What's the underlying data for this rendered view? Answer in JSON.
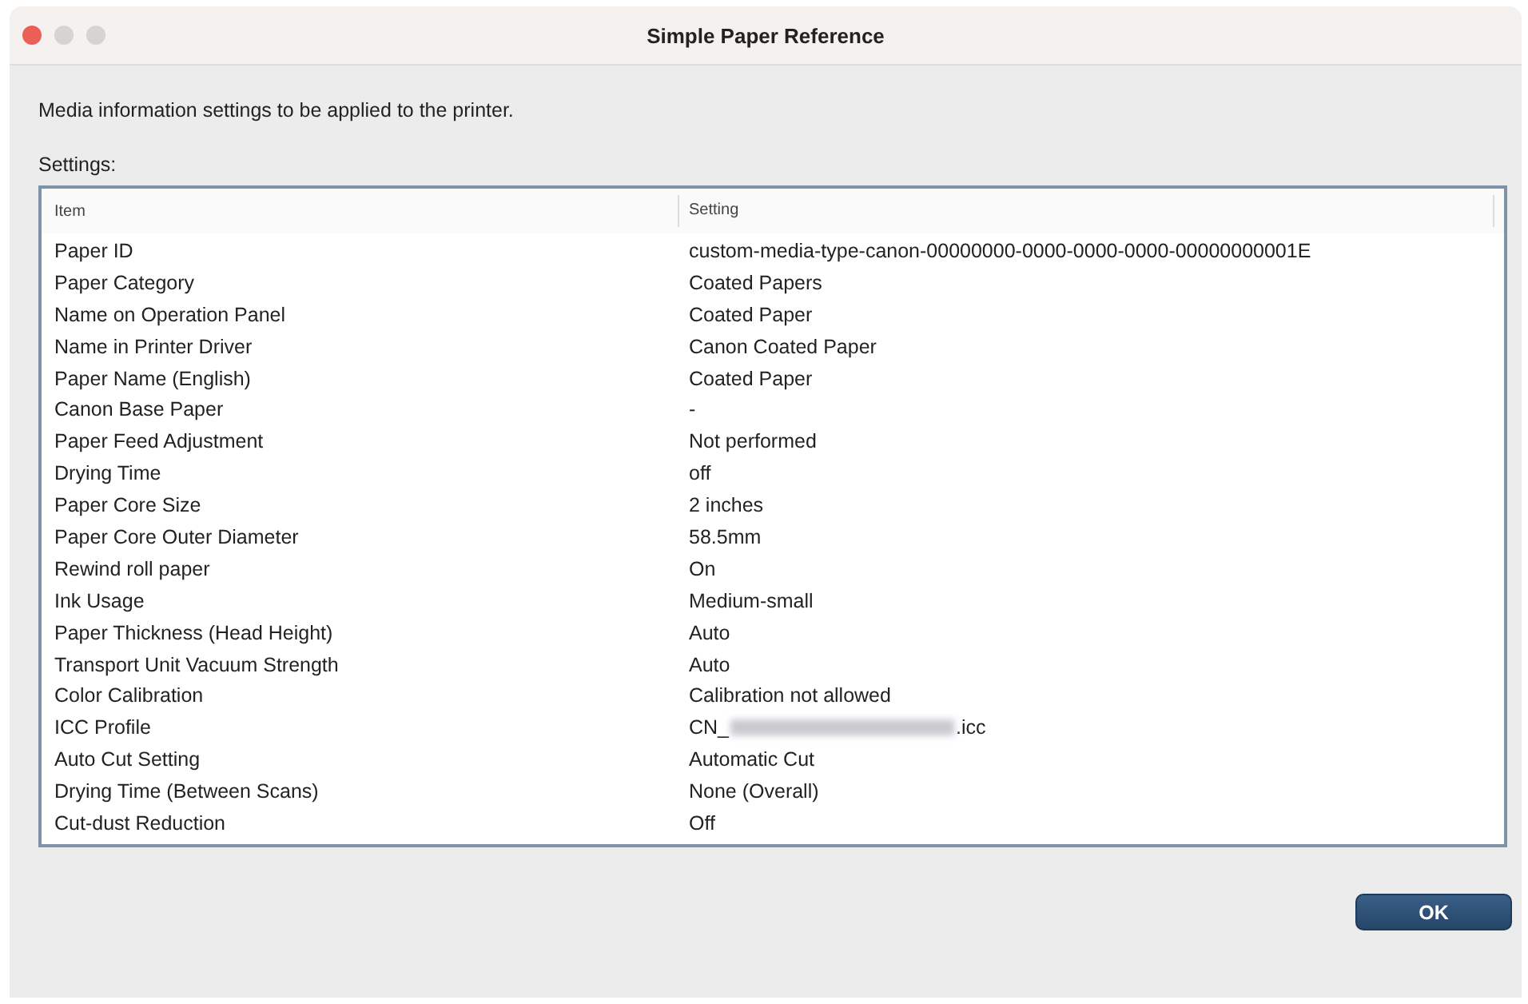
{
  "window": {
    "title": "Simple Paper Reference"
  },
  "description": "Media information settings to be applied to the printer.",
  "settings_label": "Settings:",
  "table": {
    "columns": [
      "Item",
      "Setting"
    ],
    "rows": [
      {
        "kind": "plain",
        "item": "Paper ID",
        "setting": "custom-media-type-canon-00000000-0000-0000-0000-00000000001E"
      },
      {
        "kind": "plain",
        "item": "Paper Category",
        "setting": "Coated Papers"
      },
      {
        "kind": "plain",
        "item": "Name on Operation Panel",
        "setting": "Coated Paper"
      },
      {
        "kind": "plain",
        "item": "Name in Printer Driver",
        "setting": "Canon Coated Paper"
      },
      {
        "kind": "plain",
        "item": "Paper Name (English)",
        "setting": "Coated Paper"
      },
      {
        "kind": "plain",
        "item": "Canon Base Paper",
        "setting": "-"
      },
      {
        "kind": "plain",
        "item": "Paper Feed Adjustment",
        "setting": "Not performed"
      },
      {
        "kind": "plain",
        "item": "Drying Time",
        "setting": "off"
      },
      {
        "kind": "plain",
        "item": "Paper Core Size",
        "setting": "2 inches"
      },
      {
        "kind": "plain",
        "item": "Paper Core Outer Diameter",
        "setting": "58.5mm"
      },
      {
        "kind": "plain",
        "item": "Rewind roll paper",
        "setting": "On"
      },
      {
        "kind": "plain",
        "item": "Ink Usage",
        "setting": "Medium-small"
      },
      {
        "kind": "plain",
        "item": "Paper Thickness (Head Height)",
        "setting": "Auto"
      },
      {
        "kind": "plain",
        "item": "Transport Unit Vacuum Strength",
        "setting": "Auto"
      },
      {
        "kind": "plain",
        "item": "Color Calibration",
        "setting": "Calibration not allowed"
      },
      {
        "kind": "redacted",
        "item": "ICC Profile",
        "setting_before": "CN_",
        "setting_after": ".icc"
      },
      {
        "kind": "plain",
        "item": "Auto Cut Setting",
        "setting": "Automatic Cut"
      },
      {
        "kind": "plain",
        "item": "Drying Time (Between Scans)",
        "setting": "None (Overall)"
      },
      {
        "kind": "plain",
        "item": "Cut-dust Reduction",
        "setting": "Off"
      }
    ]
  },
  "buttons": [
    {
      "label": "OK"
    }
  ]
}
